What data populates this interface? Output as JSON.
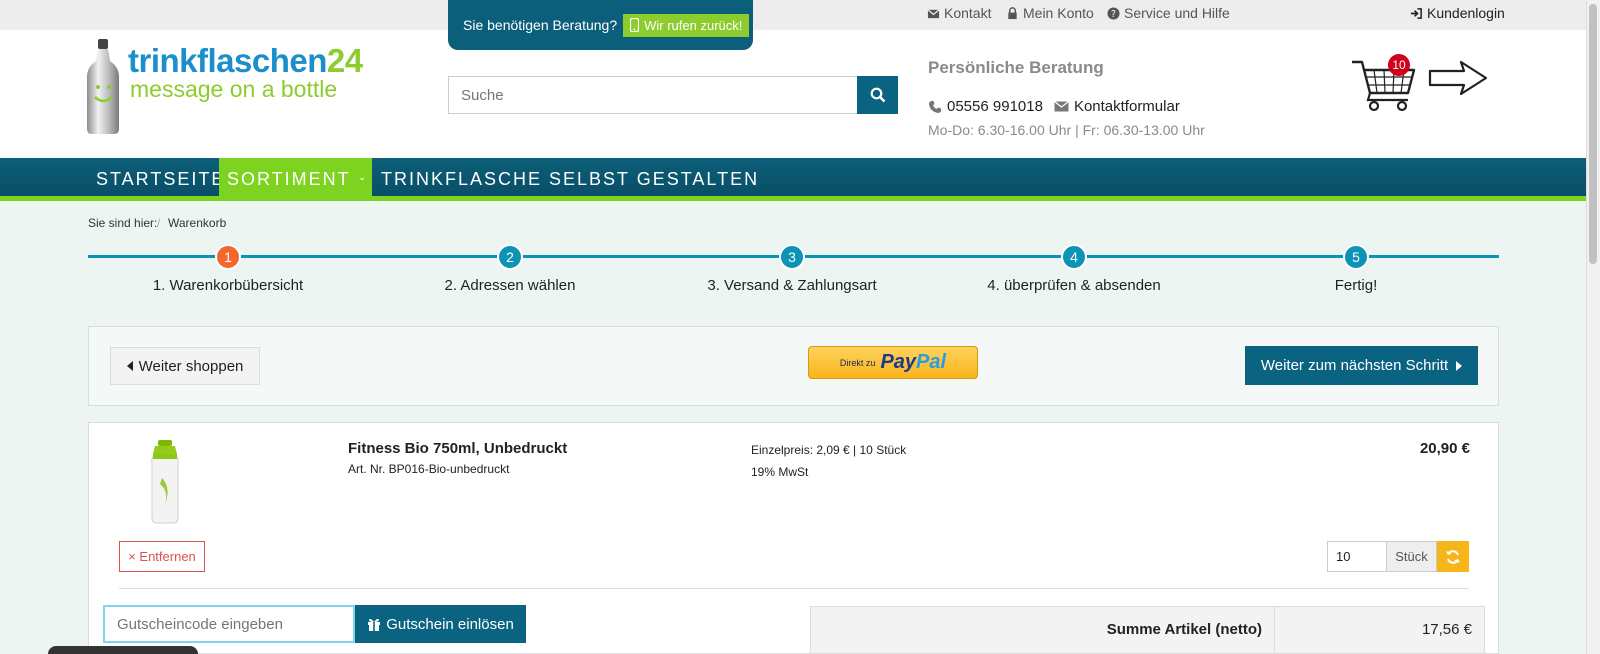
{
  "topbar": {
    "contact": "Kontakt",
    "account": "Mein Konto",
    "help": "Service und Hilfe",
    "login": "Kundenlogin"
  },
  "header": {
    "logo_brand": "trinkflaschen",
    "logo_number": "24",
    "logo_tagline": "message on a bottle",
    "consult_question": "Sie benötigen Beratung?",
    "callback_label": "Wir rufen zurück!",
    "search_placeholder": "Suche",
    "consult_title": "Persönliche Beratung",
    "phone": "05556 991018",
    "contact_form": "Kontaktformular",
    "hours": "Mo-Do: 6.30-16.00 Uhr | Fr: 06.30-13.00 Uhr",
    "cart_count": "10"
  },
  "nav": {
    "home": "STARTSEITE",
    "assortment": "SORTIMENT",
    "design": "TRINKFLASCHE SELBST GESTALTEN"
  },
  "breadcrumb": {
    "prefix": "Sie sind hier:",
    "separator": "/",
    "current": "Warenkorb"
  },
  "steps": [
    {
      "number": "1",
      "label": "1. Warenkorbübersicht"
    },
    {
      "number": "2",
      "label": "2. Adressen wählen"
    },
    {
      "number": "3",
      "label": "3. Versand & Zahlungsart"
    },
    {
      "number": "4",
      "label": "4. überprüfen & absenden"
    },
    {
      "number": "5",
      "label": "Fertig!"
    }
  ],
  "actions": {
    "continue_shopping": "Weiter shoppen",
    "paypal_prefix": "Direkt zu",
    "paypal_pay": "Pay",
    "paypal_pal": "Pal",
    "next_step": "Weiter zum nächsten Schritt"
  },
  "cart_item": {
    "name": "Fitness Bio 750ml, Unbedruckt",
    "article": "Art. Nr. BP016-Bio-unbedruckt",
    "unit_price": "Einzelpreis: 2,09 € | 10 Stück",
    "vat": "19% MwSt",
    "total": "20,90 €",
    "remove": "× Entfernen",
    "quantity": "10",
    "quantity_unit": "Stück"
  },
  "voucher": {
    "placeholder": "Gutscheincode eingeben",
    "button": "Gutschein einlösen"
  },
  "summary": {
    "label": "Summe Artikel (netto)",
    "value": "17,56 €"
  },
  "colors": {
    "primary": "#0b6382",
    "accent_green": "#7ed320",
    "step_active": "#f4672c",
    "step": "#0b94b5"
  }
}
